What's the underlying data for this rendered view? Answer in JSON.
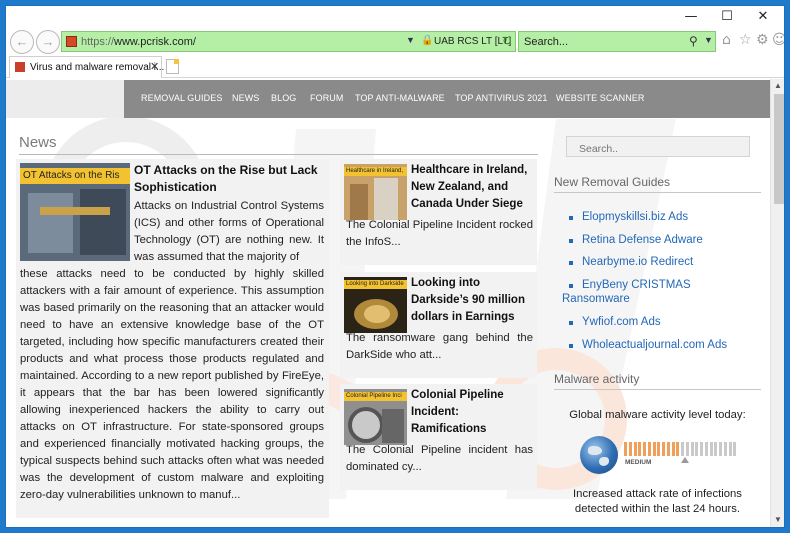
{
  "window": {
    "controls": {
      "minimize": "—",
      "maximize": "☐",
      "close": "✕"
    }
  },
  "addressbar": {
    "scheme": "https://",
    "url": "www.pcrisk.com/",
    "certificate": "UAB RCS LT [LT]",
    "search_placeholder": "Search..."
  },
  "tab": {
    "label": "Virus and malware removal i...",
    "close": "✕"
  },
  "nav": {
    "items": [
      "REMOVAL GUIDES",
      "NEWS",
      "BLOG",
      "FORUM",
      "TOP ANTI-MALWARE",
      "TOP ANTIVIRUS 2021",
      "WEBSITE SCANNER"
    ]
  },
  "news": {
    "heading": "News",
    "main": {
      "thumb_label": "OT Attacks on the Ris",
      "title": "OT Attacks on the Rise but Lack Sophistication",
      "body_a": "Attacks on Industrial Control Systems (ICS) and other forms of Operational Technology (OT) are nothing new. It was assumed that the majority of",
      "body_b": "these attacks need to be conducted by highly skilled attackers with a fair amount of experience. This assumption was based primarily on the reasoning that an attacker would need to have an extensive knowledge base of the OT targeted, including how specific manufacturers created their products and what process those products regulated and maintained. According to a new report published by FireEye, it appears that the bar has been lowered significantly allowing inexperienced hackers the ability to carry out attacks on OT infrastructure. For state-sponsored groups and experienced financially motivated hacking groups, the typical suspects behind such attacks often what was needed was the development of custom malware and exploiting zero-day vulnerabilities unknown to manuf..."
    },
    "side": [
      {
        "thumb_label": "Healthcare in Ireland,",
        "title": "Healthcare in Ireland, New Zealand, and Canada Under Siege",
        "body": "The Colonial Pipeline Incident rocked the InfoS..."
      },
      {
        "thumb_label": "Looking into Darkside",
        "title": "Looking into Darkside’s 90 million dollars in Earnings",
        "body": "The ransomware gang behind the DarkSide who att..."
      },
      {
        "thumb_label": "Colonial Pipeline Inci",
        "title": "Colonial Pipeline Incident: Ramifications",
        "body": "The Colonial Pipeline incident has dominated cy..."
      }
    ]
  },
  "sidebar": {
    "search_placeholder": "Search..",
    "guides_heading": "New Removal Guides",
    "guides": [
      "Elopmyskillsi.biz Ads",
      "Retina Defense Adware",
      "Nearbyme.io Redirect",
      "EnyBeny CRISTMAS",
      "Ransomware",
      "Ywfiof.com Ads",
      "Wholeactualjournal.com Ads"
    ],
    "malware_heading": "Malware activity",
    "malware_title": "Global malware activity level today:",
    "meter_label": "MEDIUM",
    "meter_level_fraction": 0.47,
    "malware_note_1": "Increased attack rate of infections",
    "malware_note_2": "detected within the last 24 hours."
  },
  "colors": {
    "nav_bg": "#8a8a8a",
    "link": "#2468b8",
    "address_bg": "#b4efa5",
    "window_frame": "#1f7acc",
    "meter_active": "#f0a05a"
  }
}
